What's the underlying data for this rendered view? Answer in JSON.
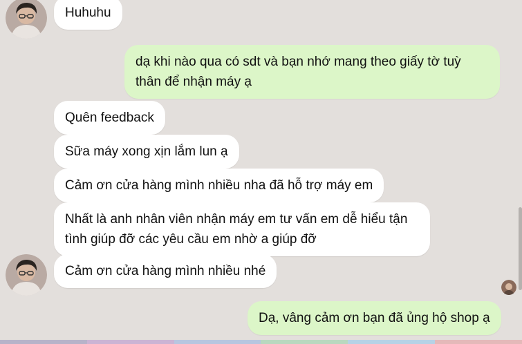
{
  "chat": {
    "messages": [
      {
        "dir": "in",
        "text": "Huhuhu"
      },
      {
        "dir": "out",
        "text": "dạ khi nào qua có sdt và bạn nhớ mang theo giấy tờ tuỳ",
        "text2": "thân để nhận máy ạ"
      },
      {
        "dir": "in",
        "text": "Quên feedback"
      },
      {
        "dir": "in",
        "text": "Sữa máy xong xịn lắm lun ạ"
      },
      {
        "dir": "in",
        "text": "Cảm ơn cửa hàng mình nhiều nha đã hỗ trợ máy em"
      },
      {
        "dir": "in",
        "text": "Nhất là anh nhân viên nhận máy em tư vấn em dễ hiểu tận",
        "text2": "tình giúp đỡ các yêu cầu em nhờ a giúp đỡ"
      },
      {
        "dir": "in",
        "text": "Cảm ơn cửa hàng mình nhiều nhé"
      },
      {
        "dir": "out",
        "text": "Dạ, vâng cảm ơn bạn đã ủng hộ shop ạ"
      }
    ]
  },
  "colors": {
    "background": "#e3dfdc",
    "incoming_bubble": "#ffffff",
    "outgoing_bubble": "#dcf6c8",
    "bottom_bar": [
      "#b7b3c9",
      "#cbb4d4",
      "#b7c6e0",
      "#b9d8bf",
      "#b6d2e6",
      "#e4b9b9"
    ]
  },
  "icons": {
    "sender_avatar": "user-avatar-icon",
    "seen_indicator": "seen-avatar-icon"
  }
}
